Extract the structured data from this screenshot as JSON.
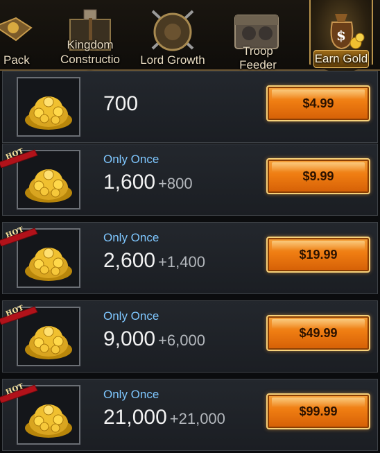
{
  "tabs": [
    {
      "label": "Pack",
      "icon": "pack-icon",
      "active": false
    },
    {
      "label": "Kingdom Constructio n",
      "icon": "hammer-icon",
      "active": false
    },
    {
      "label": "Lord Growth",
      "icon": "shield-swords-icon",
      "active": false
    },
    {
      "label": "Troop Feeder",
      "icon": "chest-icon",
      "active": false
    },
    {
      "label": "Earn Gold",
      "icon": "gold-bag-icon",
      "active": true
    }
  ],
  "packs": [
    {
      "hot": false,
      "once": "",
      "amount": "700",
      "bonus": "",
      "price": "$4.99"
    },
    {
      "hot": true,
      "hot_label": "HOT",
      "once": "Only Once",
      "amount": "1,600",
      "bonus": "+800",
      "price": "$9.99"
    },
    {
      "hot": true,
      "hot_label": "HOT",
      "once": "Only Once",
      "amount": "2,600",
      "bonus": "+1,400",
      "price": "$19.99"
    },
    {
      "hot": true,
      "hot_label": "HOT",
      "once": "Only Once",
      "amount": "9,000",
      "bonus": "+6,000",
      "price": "$49.99"
    },
    {
      "hot": true,
      "hot_label": "HOT",
      "once": "Only Once",
      "amount": "21,000",
      "bonus": "+21,000",
      "price": "$99.99"
    }
  ],
  "colors": {
    "accent": "#ef7d12",
    "once_text": "#7fc7ff",
    "gold": "#f2c430"
  }
}
